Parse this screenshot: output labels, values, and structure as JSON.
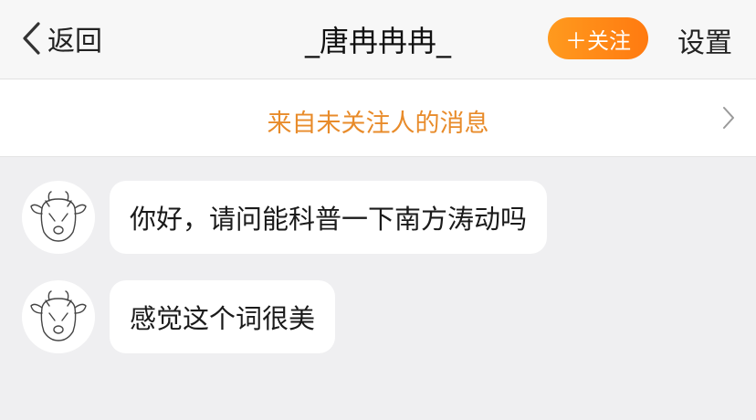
{
  "header": {
    "back_label": "返回",
    "title": "_唐冉冉冉_",
    "follow_label": "＋关注",
    "settings_label": "设置"
  },
  "notice": {
    "text": "来自未关注人的消息"
  },
  "messages": [
    {
      "text": "你好，请问能科普一下南方涛动吗"
    },
    {
      "text": "感觉这个词很美"
    }
  ],
  "colors": {
    "accent_orange": "#ff8a1a",
    "notice_text": "#e88b2a",
    "chat_background": "#efeff1"
  },
  "icons": {
    "back": "chevron-left-icon",
    "notice_arrow": "chevron-right-icon",
    "avatar": "cow-doodle-avatar"
  }
}
